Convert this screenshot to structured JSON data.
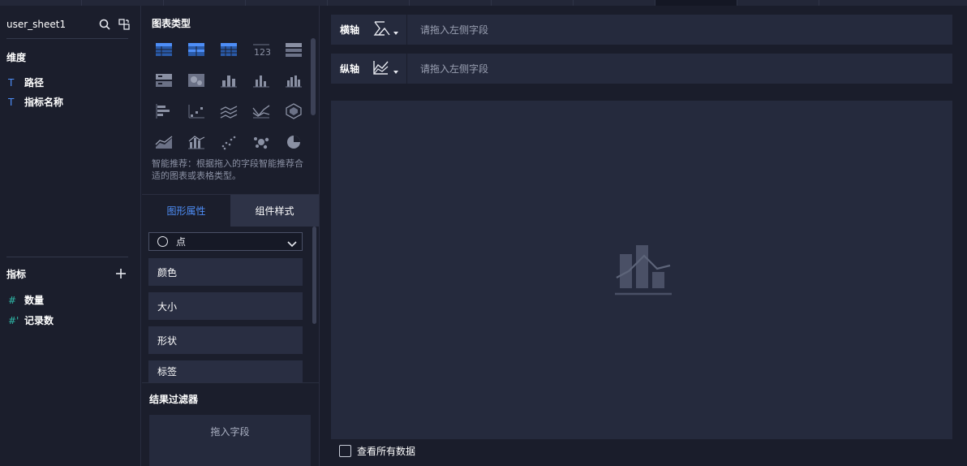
{
  "dataset": {
    "name": "user_sheet1",
    "search_icon": "search-icon",
    "switch_icon": "switch-dataset-icon"
  },
  "dimensions": {
    "title": "维度",
    "items": [
      {
        "type_icon": "T",
        "label": "路径"
      },
      {
        "type_icon": "T",
        "label": "指标名称"
      }
    ]
  },
  "measures": {
    "title": "指标",
    "add_icon": "plus-icon",
    "items": [
      {
        "type_icon": "#",
        "label": "数量"
      },
      {
        "type_icon": "#'",
        "label": "记录数"
      }
    ]
  },
  "chart_types": {
    "title": "图表类型",
    "icons": [
      "table-icon",
      "crosstab-icon",
      "grouped-table-icon",
      "kpi-number-icon",
      "list-card-icon",
      "dashboard-card-icon",
      "heatmap-icon",
      "stacked-column-icon",
      "column-icon",
      "grouped-column-icon",
      "bar-icon",
      "scatter-step-icon",
      "line-multi-icon",
      "line-area-icon",
      "radar-icon",
      "area-icon",
      "column-line-icon",
      "scatter-icon",
      "bubble-icon",
      "pie-icon"
    ],
    "hint": "智能推荐：根据拖入的字段智能推荐合适的图表或表格类型。"
  },
  "tabs": {
    "graphic_props": "图形属性",
    "component_style": "组件样式"
  },
  "mark_type": {
    "selected": "点",
    "icon": "circle-icon"
  },
  "properties": [
    "颜色",
    "大小",
    "形状",
    "标签"
  ],
  "result_filter": {
    "title": "结果过滤器",
    "drop_hint": "拖入字段"
  },
  "x_axis": {
    "label": "横轴",
    "placeholder": "请拖入左侧字段"
  },
  "y_axis": {
    "label": "纵轴",
    "placeholder": "请拖入左侧字段"
  },
  "view_all": {
    "label": "查看所有数据",
    "checked": false
  }
}
